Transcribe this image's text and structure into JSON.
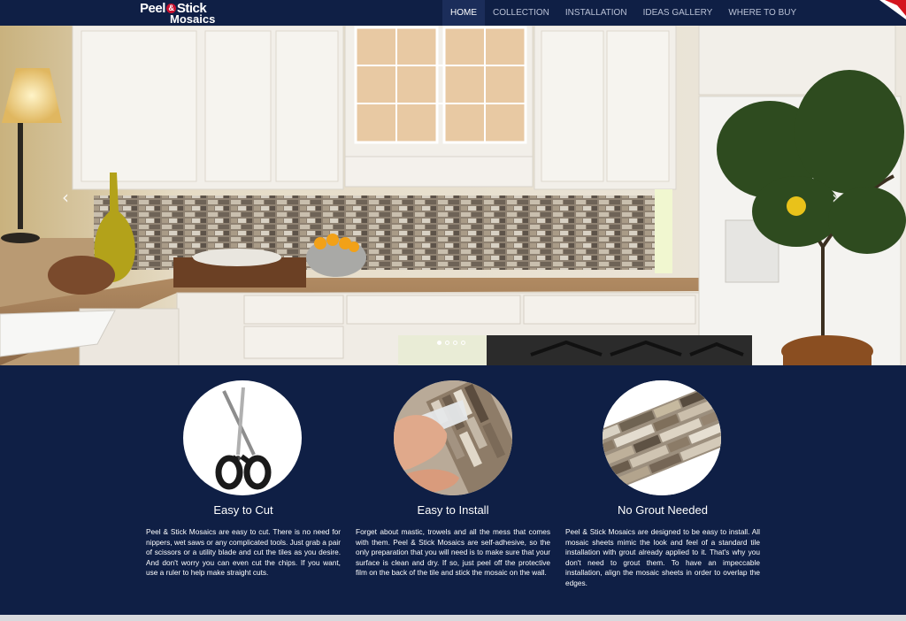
{
  "brand": {
    "line1": "Peel",
    "amp": "&",
    "line1b": "Stick",
    "line2": "Mosaics"
  },
  "nav": {
    "items": [
      {
        "label": "HOME",
        "active": true
      },
      {
        "label": "COLLECTION",
        "active": false
      },
      {
        "label": "INSTALLATION",
        "active": false
      },
      {
        "label": "IDEAS GALLERY",
        "active": false
      },
      {
        "label": "WHERE TO BUY",
        "active": false
      }
    ]
  },
  "slider": {
    "prev_icon": "chevron-left-icon",
    "next_icon": "chevron-right-icon",
    "slide_count": 4,
    "active_slide": 1
  },
  "features": [
    {
      "icon": "scissors-image",
      "title": "Easy to Cut",
      "text": "Peel & Stick Mosaics are easy to cut. There is no need for nippers, wet saws or any complicated tools. Just grab a pair of scissors or a utility blade and cut the tiles as you desire. And don't worry you can even cut the chips. If you want, use a ruler to help make straight cuts."
    },
    {
      "icon": "hands-installing-image",
      "title": "Easy to Install",
      "text": "Forget about mastic, trowels and all the mess that comes with them. Peel & Stick Mosaics are self-adhesive, so the only preparation that you will need is to make sure that your surface is clean and dry. If so, just peel off the protective film on the back of the tile and stick the mosaic on the wall."
    },
    {
      "icon": "mosaic-tile-image",
      "title": "No Grout Needed",
      "text": "Peel & Stick Mosaics are designed to be easy to install. All mosaic sheets mimic the look and feel of a standard tile installation with grout already applied to it. That's why you don't need to grout them. To have an impeccable installation, align the mosaic sheets in order to overlap the edges."
    }
  ],
  "colors": {
    "navy": "#0f1f45",
    "nav_active": "#1b2d5a",
    "brand_red": "#c8102e"
  }
}
